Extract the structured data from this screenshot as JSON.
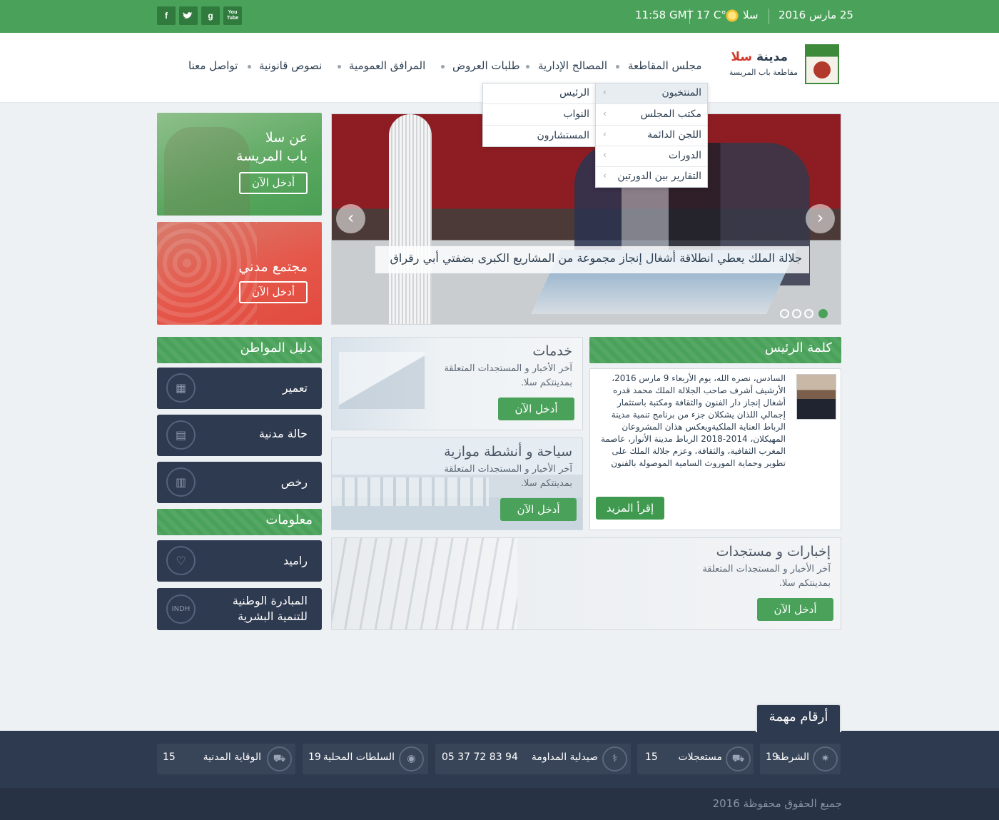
{
  "topbar": {
    "date": "25 مارس 2016",
    "city": "سلا",
    "temp": "17 C°",
    "time": "11:58 GMT",
    "social": [
      {
        "icon": "facebook-icon",
        "glyph": "f"
      },
      {
        "icon": "twitter-icon",
        "glyph": "t"
      },
      {
        "icon": "google-icon",
        "glyph": "g"
      },
      {
        "icon": "youtube-icon",
        "glyph": "You Tube"
      }
    ]
  },
  "header": {
    "logo_word1": "مدينة",
    "logo_word2": "سلا",
    "logo_sub": "مقاطعة باب المريسة",
    "nav": [
      "مجلس المقاطعة",
      "المصالح الإدارية",
      "طلبات العروض",
      "المرافق العمومية",
      "نصوص قانونية",
      "تواصل معنا"
    ]
  },
  "dropdown": {
    "main": [
      "المنتخبون",
      "مكتب المجلس",
      "اللجن الدائمة",
      "الدورات",
      "التقارير بين الدورتين"
    ],
    "sub": [
      "الرئيس",
      "النواب",
      "المستشارون"
    ]
  },
  "slider": {
    "caption": "جلالة الملك يعطي انطلاقة أشغال إنجاز مجموعة من المشاريع الكبرى بضفتي أبي رقراق",
    "prev": "‹",
    "next": "›"
  },
  "promos": [
    {
      "title1": "عن سلا",
      "title2": "باب المريسة",
      "button": "أدخل الآن"
    },
    {
      "title1": "مجتمع مدني",
      "title2": "",
      "button": "أدخل الآن"
    }
  ],
  "guide": {
    "title": "دليل المواطن",
    "items": [
      {
        "label": "تعمير",
        "icon": "building-icon"
      },
      {
        "label": "حالة مدنية",
        "icon": "id-card-icon"
      },
      {
        "label": "رخص",
        "icon": "document-icon"
      }
    ]
  },
  "info": {
    "title": "معلومات",
    "items": [
      {
        "label": "راميد",
        "icon": "heartbeat-icon"
      },
      {
        "label": "المبادرة الوطنية",
        "label2": "للتنمية البشرية",
        "icon": "indh-icon",
        "glyph": "INDH"
      }
    ]
  },
  "cards": {
    "services": {
      "title": "خدمات",
      "desc1": "آخر الأخبار و المستجدات المتعلقة",
      "desc2": "بمدينتكم سلا.",
      "button": "أدخل الآن"
    },
    "tourism": {
      "title": "سياحة و أنشطة موازية",
      "desc1": "آخر الأخبار و المستجدات المتعلقة",
      "desc2": "بمدينتكم سلا.",
      "button": "أدخل الآن"
    },
    "news": {
      "title": "إخبارات و مستجدات",
      "desc1": "آخر الأخبار و المستجدات المتعلقة",
      "desc2": "بمدينتكم سلا.",
      "button": "أدخل الآن"
    }
  },
  "president": {
    "title": "كلمة الرئيس",
    "text": "السادس، نصره الله، يوم الأربعاء 9 مارس 2016، الأرشيف أشرف صاحب الجلالة الملك محمد قدره أشغال إنجاز دار الفنون والثقافة ومكتبة باستثمار إجمالي اللذان يشكلان جزء من برنامج تنمية مدينة الرباط العناية الملكيةويعكس هذان المشروعان المهيكلان، 2014-2018 الرباط مدينة الأنوار، عاصمة المغرب الثقافية، والثقافة، وعزم جلالة الملك على تطوير وحماية الموروث السامية الموصولة بالفنون",
    "button": "إقرأ المزيد"
  },
  "numbers": {
    "tab": "أرقام مهمة",
    "items": [
      {
        "label": "الشرطة",
        "value": "19",
        "icon": "police-star-icon"
      },
      {
        "label": "مستعجلات",
        "value": "15",
        "icon": "ambulance-icon"
      },
      {
        "label": "صيدلية المداومة",
        "value": "05 37 72 83 94",
        "icon": "pharmacy-icon"
      },
      {
        "label": "السلطات المحلية",
        "value": "19",
        "icon": "authority-icon"
      },
      {
        "label": "الوقاية المدنية",
        "value": "15",
        "icon": "fire-truck-icon"
      }
    ]
  },
  "footer": {
    "copyright": "جميع الحقوق محفوظة 2016"
  },
  "colors": {
    "green": "#4aa25a",
    "navy": "#2e3a4f",
    "red": "#e14b3e"
  }
}
